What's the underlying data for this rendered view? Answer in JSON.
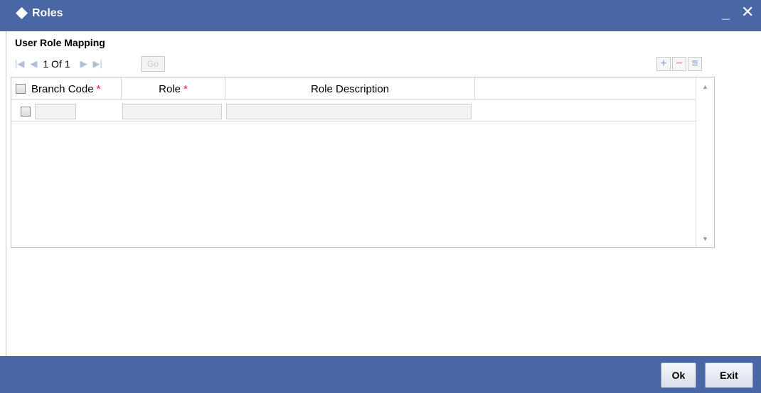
{
  "window": {
    "title": "Roles",
    "minimize_label": "_",
    "close_label": "✕"
  },
  "section": {
    "title": "User Role Mapping"
  },
  "pager": {
    "page_text": "1 Of 1",
    "go_label": "Go"
  },
  "toolbar": {
    "add_icon": "plus-icon",
    "remove_icon": "minus-icon",
    "view_icon": "list-icon"
  },
  "grid": {
    "columns": [
      {
        "label": "Branch Code",
        "required": "*"
      },
      {
        "label": "Role",
        "required": "*"
      },
      {
        "label": "Role Description",
        "required": ""
      }
    ],
    "rows": [
      {
        "branch_code": "",
        "role": "",
        "role_description": ""
      }
    ]
  },
  "footer": {
    "ok_label": "Ok",
    "exit_label": "Exit"
  },
  "colors": {
    "titlebar": "#4a67a5",
    "required": "#dd2222"
  }
}
